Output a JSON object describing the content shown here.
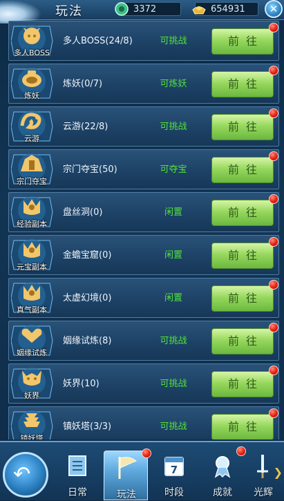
{
  "header": {
    "title": "玩法",
    "jade": "3372",
    "gold": "654931",
    "close_icon": "close-icon"
  },
  "colors": {
    "status_green": "#52e23a",
    "button_green": "#97d85e",
    "panel_blue": "#1d4266",
    "red_dot": "#e8200f"
  },
  "rows": [
    {
      "emblem": "多人BOSS",
      "name": "多人BOSS(24/8)",
      "status": "可挑战",
      "button": "前往",
      "dot": true
    },
    {
      "emblem": "炼妖",
      "name": "炼妖(0/7)",
      "status": "可炼妖",
      "button": "前往",
      "dot": true
    },
    {
      "emblem": "云游",
      "name": "云游(22/8)",
      "status": "可挑战",
      "button": "前往",
      "dot": true
    },
    {
      "emblem": "宗门夺宝",
      "name": "宗门夺宝(50)",
      "status": "可夺宝",
      "button": "前往",
      "dot": true
    },
    {
      "emblem": "经验副本",
      "name": "盘丝洞(0)",
      "status": "闲置",
      "button": "前往",
      "dot": true
    },
    {
      "emblem": "元宝副本",
      "name": "金蟾宝窟(0)",
      "status": "闲置",
      "button": "前往",
      "dot": true
    },
    {
      "emblem": "真气副本",
      "name": "太虚幻境(0)",
      "status": "闲置",
      "button": "前往",
      "dot": true
    },
    {
      "emblem": "姻缘试炼",
      "name": "姻缘试炼(8)",
      "status": "可挑战",
      "button": "前往",
      "dot": true
    },
    {
      "emblem": "妖界",
      "name": "妖界(10)",
      "status": "可挑战",
      "button": "前往",
      "dot": true
    },
    {
      "emblem": "镇妖塔",
      "name": "镇妖塔(3/3)",
      "status": "可挑战",
      "button": "前往",
      "dot": true
    }
  ],
  "bottom_nav": {
    "back_icon": "back-arrow-icon",
    "tabs": [
      {
        "label": "日常",
        "icon": "scroll-icon",
        "dot": false
      },
      {
        "label": "玩法",
        "icon": "flag-icon",
        "dot": true
      },
      {
        "label": "时段",
        "icon": "calendar-icon",
        "calendar_day": "7",
        "dot": false
      },
      {
        "label": "成就",
        "icon": "ribbon-icon",
        "dot": true
      },
      {
        "label": "光辉",
        "icon": "sword-icon",
        "dot": false
      }
    ]
  }
}
